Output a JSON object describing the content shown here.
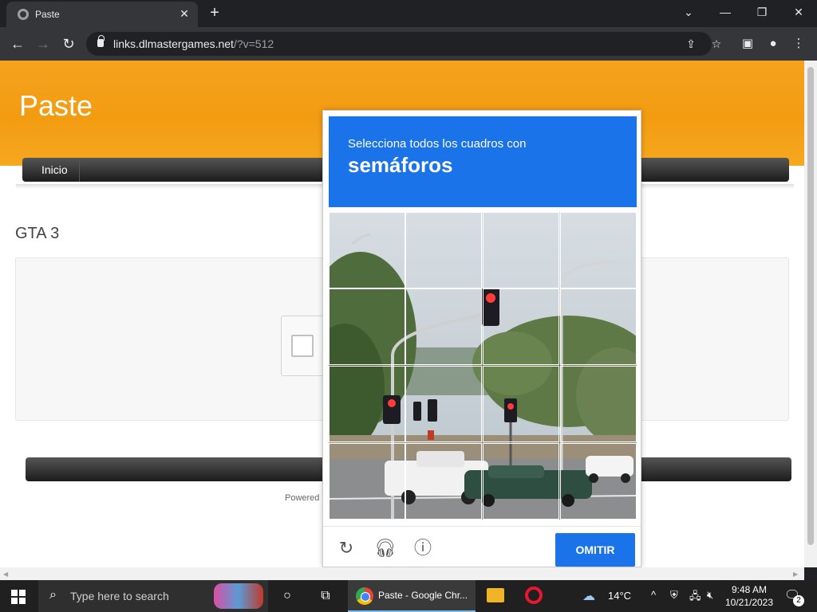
{
  "browser": {
    "tab_title": "Paste",
    "url_domain": "links.dlmastergames.net",
    "url_path": "/?v=512"
  },
  "page": {
    "site_title": "Paste",
    "menu": [
      "Inicio"
    ],
    "post_title": "GTA 3",
    "powered_text": "Powered"
  },
  "captcha": {
    "instruction": "Selecciona todos los cuadros con",
    "target": "semáforos",
    "skip_label": "OMITIR",
    "grid_rows": 4,
    "grid_cols": 4
  },
  "taskbar": {
    "search_placeholder": "Type here to search",
    "chrome_label": "Paste - Google Chr...",
    "temperature": "14°C",
    "time": "9:48 AM",
    "date": "10/21/2023",
    "notification_count": "2"
  }
}
